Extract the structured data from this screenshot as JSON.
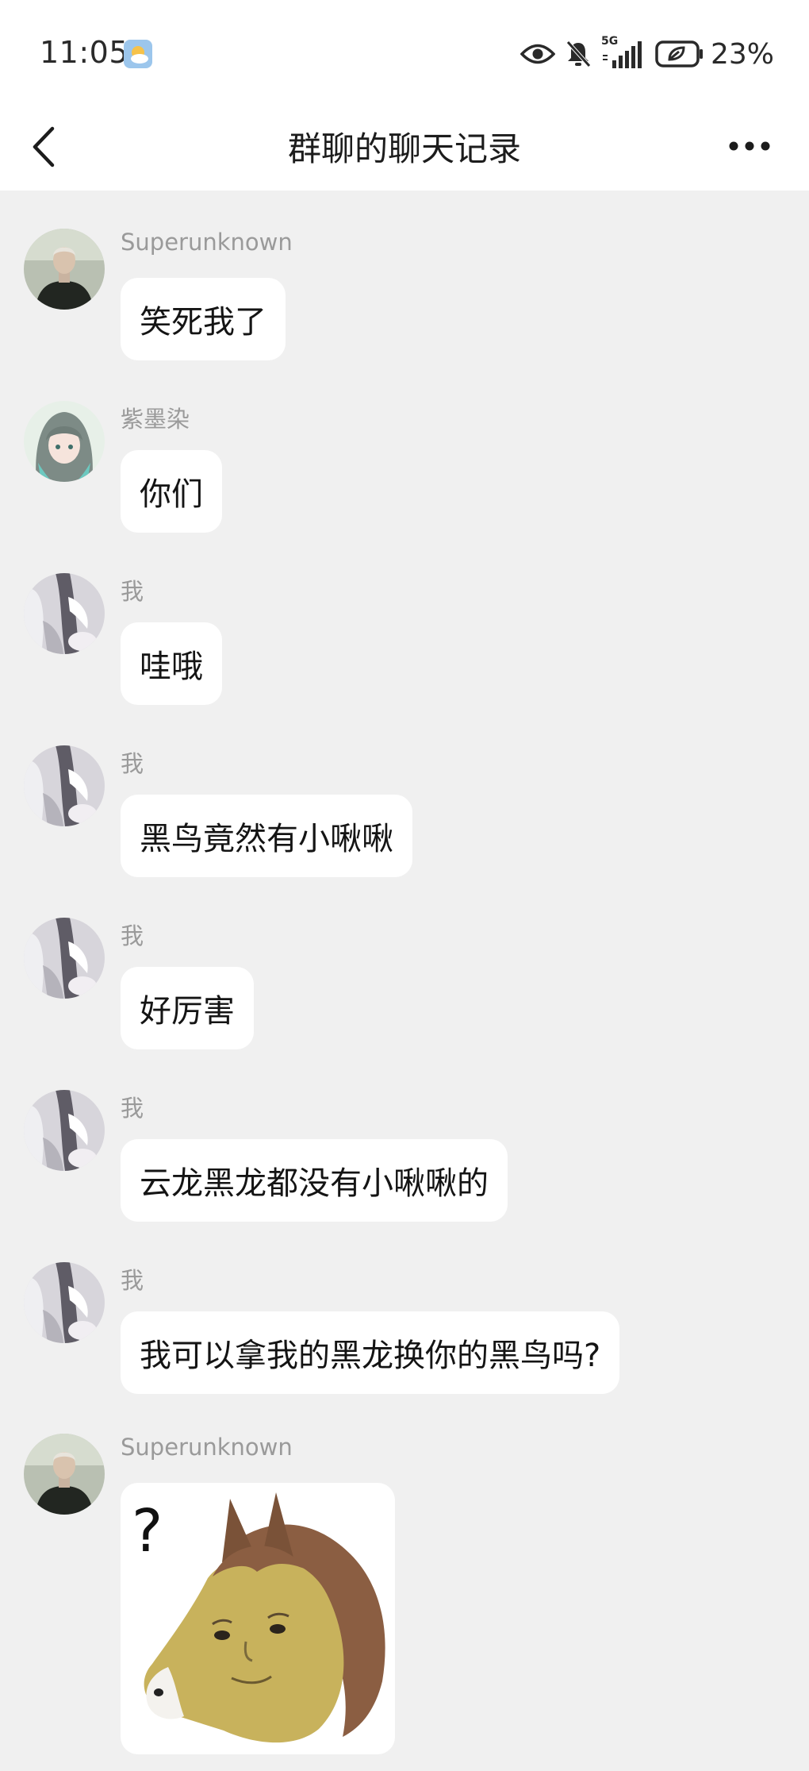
{
  "status_bar": {
    "time": "11:05",
    "network": "5G",
    "battery": "23%",
    "icons": [
      "weather-icon",
      "eye-icon",
      "mute-bell-icon",
      "signal-5g-icon",
      "battery-saver-icon"
    ]
  },
  "nav": {
    "title": "群聊的聊天记录",
    "back_icon": "chevron-left-icon",
    "more_icon": "more-dots-icon"
  },
  "messages": [
    {
      "sender": "Superunknown",
      "text": "笑死我了",
      "avatar": "avatar-superunknown"
    },
    {
      "sender": "紫墨染",
      "text": "你们",
      "avatar": "avatar-zimoran"
    },
    {
      "sender": "我",
      "text": "哇哦",
      "avatar": "avatar-me"
    },
    {
      "sender": "我",
      "text": "黑鸟竟然有小啾啾",
      "avatar": "avatar-me"
    },
    {
      "sender": "我",
      "text": "好厉害",
      "avatar": "avatar-me"
    },
    {
      "sender": "我",
      "text": "云龙黑龙都没有小啾啾的",
      "avatar": "avatar-me"
    },
    {
      "sender": "我",
      "text": "我可以拿我的黑龙换你的黑鸟吗?",
      "avatar": "avatar-me"
    },
    {
      "sender": "Superunknown",
      "sticker_text": "?",
      "sticker": "horse-face-sticker",
      "avatar": "avatar-superunknown"
    }
  ],
  "colors": {
    "background": "#f0f0f0",
    "bubble": "#ffffff",
    "sender_name": "#9a9a9a",
    "message_text": "#141414"
  }
}
